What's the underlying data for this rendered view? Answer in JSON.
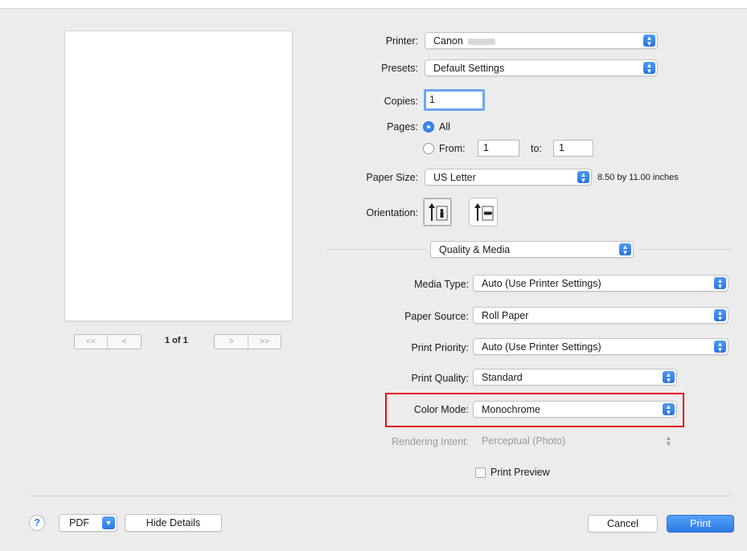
{
  "preview": {
    "page_indicator": "1 of 1"
  },
  "printer": {
    "label": "Printer:",
    "value": "Canon"
  },
  "presets": {
    "label": "Presets:",
    "value": "Default Settings"
  },
  "copies": {
    "label": "Copies:",
    "value": "1"
  },
  "pages": {
    "label": "Pages:",
    "all_label": "All",
    "from_label": "From:",
    "from_value": "1",
    "to_label": "to:",
    "to_value": "1",
    "selected": "All"
  },
  "paper_size": {
    "label": "Paper Size:",
    "value": "US Letter",
    "dimensions": "8.50 by 11.00 inches"
  },
  "orientation": {
    "label": "Orientation:",
    "selected": "portrait"
  },
  "section": {
    "value": "Quality & Media"
  },
  "media_type": {
    "label": "Media Type:",
    "value": "Auto (Use Printer Settings)"
  },
  "paper_source": {
    "label": "Paper Source:",
    "value": "Roll Paper"
  },
  "print_priority": {
    "label": "Print Priority:",
    "value": "Auto (Use Printer Settings)"
  },
  "print_quality": {
    "label": "Print Quality:",
    "value": "Standard"
  },
  "color_mode": {
    "label": "Color Mode:",
    "value": "Monochrome"
  },
  "rendering_intent": {
    "label": "Rendering Intent:",
    "value": "Perceptual (Photo)",
    "enabled": false
  },
  "print_preview": {
    "label": "Print Preview",
    "checked": false
  },
  "footer": {
    "help_label": "?",
    "pdf_label": "PDF",
    "hide_details_label": "Hide Details",
    "cancel_label": "Cancel",
    "print_label": "Print"
  },
  "colors": {
    "accent": "#2a79e6",
    "highlight_border": "#e0101a"
  }
}
